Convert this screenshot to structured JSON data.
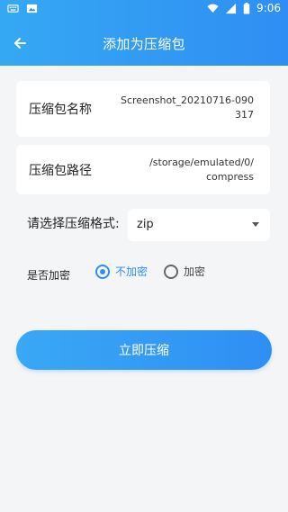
{
  "status_bar": {
    "time": "9:06",
    "icons": [
      "keyboard-icon",
      "image-icon",
      "wifi-icon",
      "signal-icon",
      "battery-icon"
    ]
  },
  "toolbar": {
    "title": "添加为压缩包",
    "back_icon": "arrow-left-icon"
  },
  "form": {
    "name": {
      "label": "压缩包名称",
      "value_line1": "Screenshot_20210716-090",
      "value_line2": "317"
    },
    "path": {
      "label": "压缩包路径",
      "value_line1": "/storage/emulated/0/",
      "value_line2": "compress"
    },
    "format": {
      "label": "请选择压缩格式:",
      "selected": "zip"
    },
    "encryption": {
      "label": "是否加密",
      "options": [
        {
          "label": "不加密",
          "checked": true
        },
        {
          "label": "加密",
          "checked": false
        }
      ]
    }
  },
  "action": {
    "label": "立即压缩"
  },
  "colors": {
    "accent": "#2f8ef3",
    "header_start": "#35a8f3",
    "background": "#f4f5f7"
  }
}
